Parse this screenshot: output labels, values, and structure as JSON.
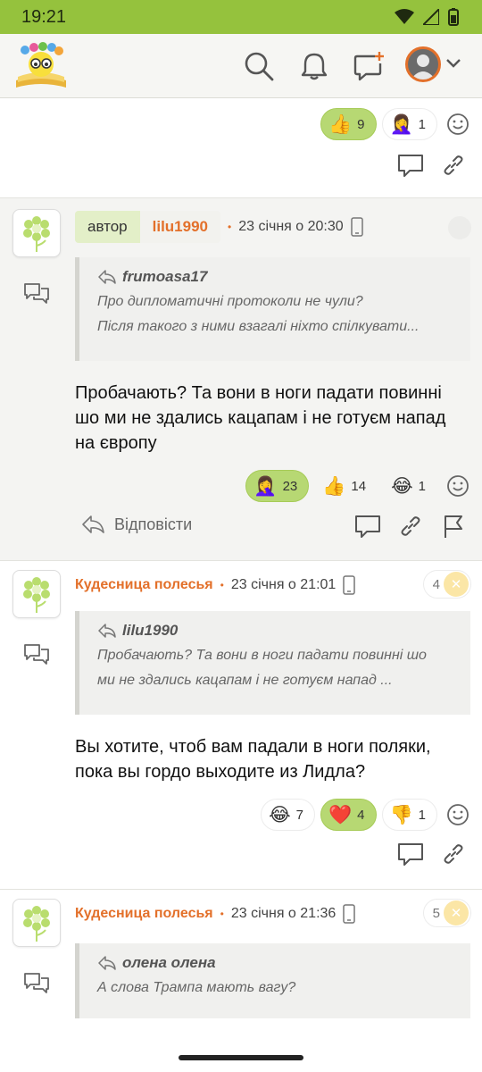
{
  "status": {
    "time": "19:21"
  },
  "header": {
    "icons": [
      "search-icon",
      "bell-icon",
      "new-post-icon",
      "avatar",
      "chevron-down-icon"
    ]
  },
  "colors": {
    "brand_green": "#95c23d",
    "accent_orange": "#e3702a",
    "active_pill": "#b7d873"
  },
  "top_post": {
    "reactions": [
      {
        "emoji": "👍",
        "count": "9",
        "active": true
      },
      {
        "emoji": "🤦‍♀️",
        "count": "1",
        "active": false
      }
    ]
  },
  "comments": [
    {
      "author_badge": "автор",
      "username": "lilu1990",
      "date": "23 січня о 20:30",
      "quote_user": "frumoasa17",
      "quote_lines": [
        "Про дипломатичні протоколи не чули?",
        "Після такого з ними взагалі ніхто спілкувати..."
      ],
      "body": "Пробачають? Та вони в ноги падати повинні шо ми не здались кацапам і не готуєм напад на європу",
      "reactions": [
        {
          "emoji": "🤦‍♀️",
          "count": "23",
          "active": true
        },
        {
          "emoji": "👍",
          "count": "14",
          "active": false
        },
        {
          "emoji": "😂",
          "count": "1",
          "active": false
        }
      ],
      "reply_label": "Відповісти"
    },
    {
      "username": "Кудесница полесья",
      "date": "23 січня о 21:01",
      "count": "4",
      "quote_user": "lilu1990",
      "quote_lines": [
        "Пробачають? Та вони в ноги падати повинні шо",
        "ми не здались кацапам і не готуєм напад ..."
      ],
      "body": "Вы хотите, чтоб вам падали в ноги поляки, пока вы гордо выходите из Лидла?",
      "reactions": [
        {
          "emoji": "😂",
          "count": "7",
          "active": false
        },
        {
          "emoji": "❤️",
          "count": "4",
          "active": true
        },
        {
          "emoji": "👎",
          "count": "1",
          "active": false
        }
      ]
    },
    {
      "username": "Кудесница полесья",
      "date": "23 січня о 21:36",
      "count": "5",
      "quote_user": "олена олена",
      "quote_lines": [
        "А слова Трампа мають вагу?"
      ]
    }
  ]
}
